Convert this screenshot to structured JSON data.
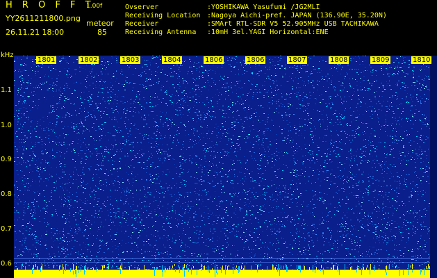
{
  "header": {
    "title": "H R O F F T",
    "version": "1.00f",
    "filename": "YY2611211800.png",
    "datetime": "26.11.21 18:00",
    "detection_type": "meteor",
    "detection_count": "85"
  },
  "meta": [
    {
      "label": "Ovserver",
      "value": ":YOSHIKAWA Yasufumi /JG2MLI"
    },
    {
      "label": "Receiving Location",
      "value": ":Nagoya Aichi-pref. JAPAN (136.90E, 35.20N)"
    },
    {
      "label": "Receiver",
      "value": ":SMArt RTL-SDR V5 52.905MHz USB TACHIKAWA"
    },
    {
      "label": "Receiving Antenna",
      "value": ":10mH 3el.YAGI Horizontal:ENE"
    }
  ],
  "axis": {
    "unit": "kHz",
    "y_labels": [
      "1.1",
      "1.0",
      "0.9",
      "0.8",
      "0.7",
      "0.6"
    ],
    "time_labels": [
      "1801",
      "1802",
      "1803",
      "1804",
      "1806",
      "1806",
      "1807",
      "1808",
      "1809",
      "1810"
    ]
  },
  "colors": {
    "background": "#000000",
    "text": "#ffff00",
    "spectrogram_base": "#0a1e8c",
    "noise_light": "#00c8ff",
    "noise_mid": "#1e64dc"
  }
}
